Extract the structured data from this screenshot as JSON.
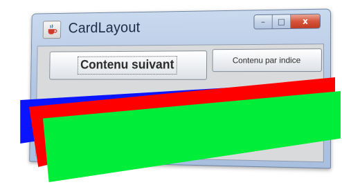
{
  "window": {
    "title": "CardLayout",
    "controls": {
      "minimize_glyph": "–",
      "maximize_glyph": "□",
      "close_glyph": "x"
    }
  },
  "buttons": {
    "next_label": "Contenu suivant",
    "by_index_label": "Contenu par indice"
  },
  "cards": [
    {
      "name": "blue-card",
      "color": "#0a14ff"
    },
    {
      "name": "red-card",
      "color": "#ff0000"
    },
    {
      "name": "green-card",
      "color": "#00ee3a"
    }
  ],
  "icons": {
    "app_icon": "java-cup-icon"
  }
}
